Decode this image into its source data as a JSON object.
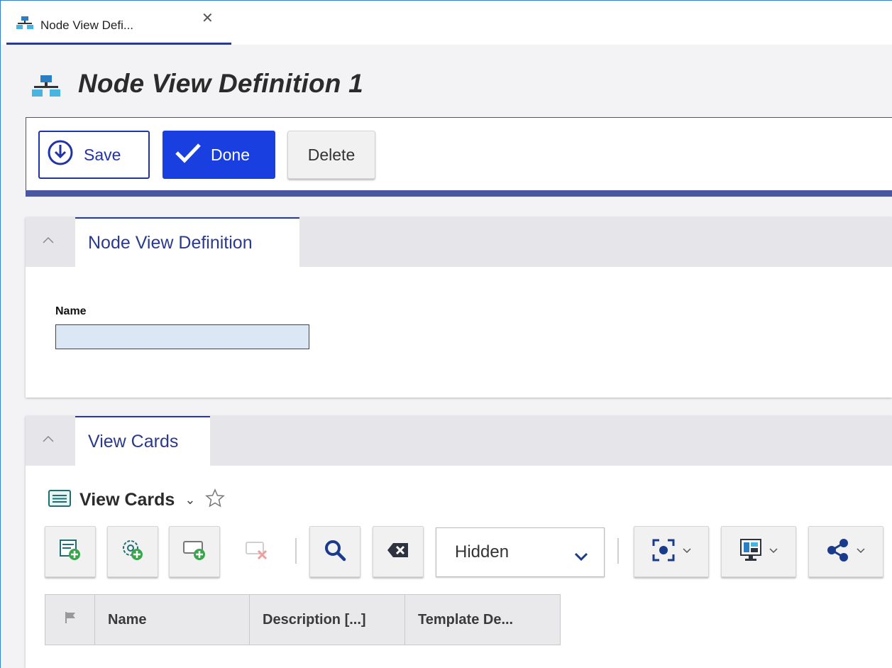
{
  "tab": {
    "label": "Node View Defi...",
    "close_glyph": "✕",
    "icon": "node-network-icon"
  },
  "header": {
    "title": "Node View Definition 1",
    "icon": "node-network-icon"
  },
  "toolbar": {
    "save_label": "Save",
    "done_label": "Done",
    "delete_label": "Delete"
  },
  "node_panel": {
    "tab_label": "Node View Definition",
    "name_label": "Name",
    "name_value": ""
  },
  "cards_panel": {
    "tab_label": "View Cards",
    "grid_title": "View Cards",
    "grid_title_chevron": "⌄",
    "filter_select": "Hidden",
    "columns": [
      "Name",
      "Description [...]",
      "Template De..."
    ],
    "tool_icons": [
      "add-row-icon",
      "add-settings-icon",
      "add-card-icon",
      "delete-card-icon",
      "search-icon",
      "clear-filter-icon",
      "focus-icon",
      "layout-icon",
      "share-icon"
    ]
  },
  "colors": {
    "accent": "#1a3fe0",
    "navy": "#2a3a8c",
    "input_bg": "#dce7f5"
  }
}
